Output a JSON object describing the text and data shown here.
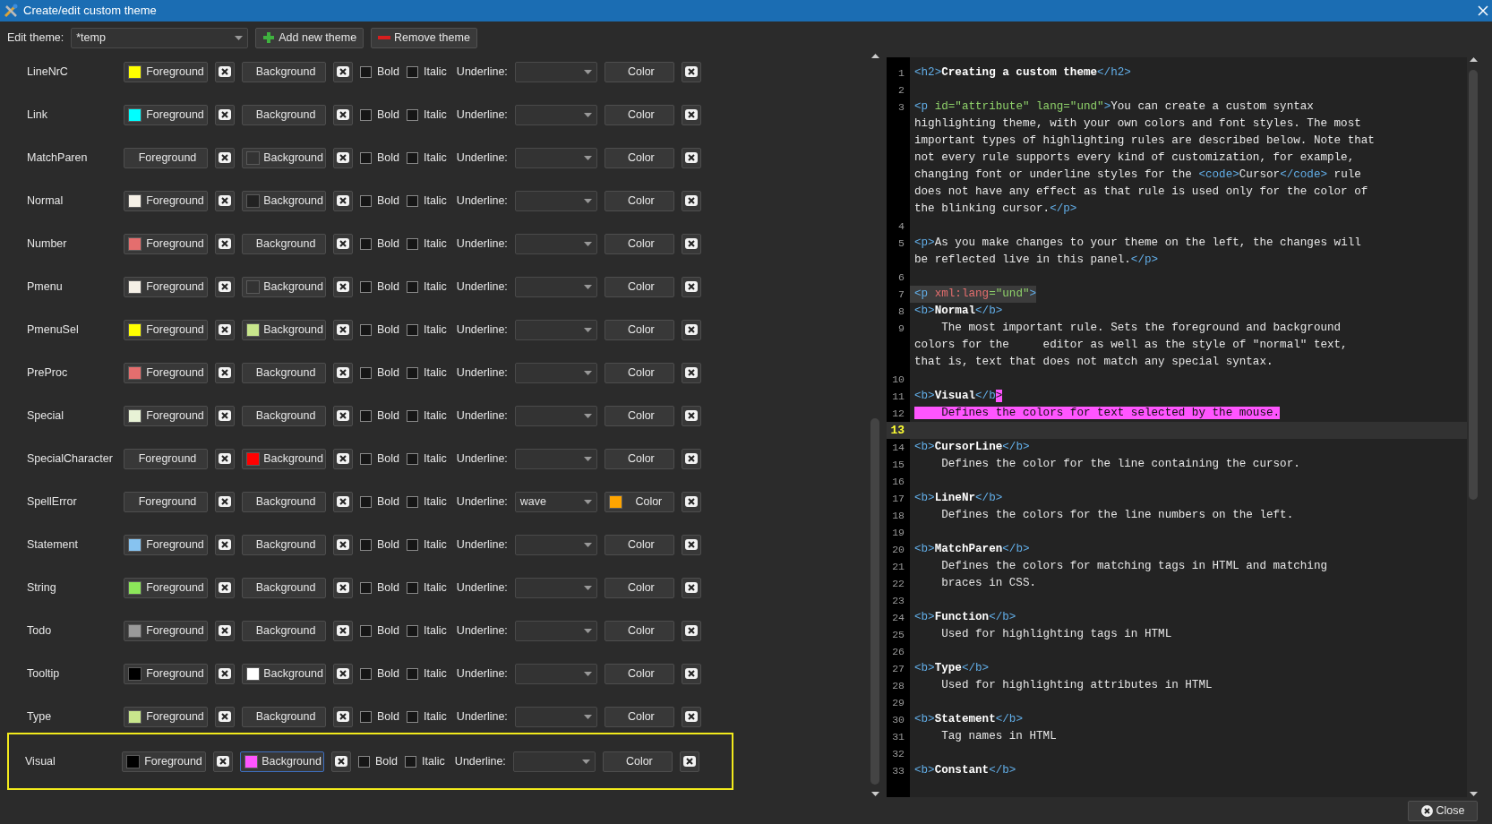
{
  "window": {
    "title": "Create/edit custom theme"
  },
  "toolbar": {
    "label": "Edit theme:",
    "theme": "*temp",
    "buttons": [
      {
        "kind": "add",
        "label": "Add new theme"
      },
      {
        "kind": "remove",
        "label": "Remove theme"
      }
    ]
  },
  "rules": [
    {
      "name": "LineNrC",
      "foreground": {
        "label": "Foreground",
        "color": "#ffff00"
      },
      "background": {
        "label": "Background"
      },
      "bold": {
        "label": "Bold",
        "checked": false
      },
      "italic": {
        "label": "Italic",
        "checked": false
      },
      "underline": {
        "label": "Underline:"
      },
      "underline_color": {
        "label": "Color"
      },
      "selected": false
    },
    {
      "name": "Link",
      "foreground": {
        "label": "Foreground",
        "color": "#00ffff"
      },
      "background": {
        "label": "Background"
      },
      "bold": {
        "label": "Bold",
        "checked": false
      },
      "italic": {
        "label": "Italic",
        "checked": false
      },
      "underline": {
        "label": "Underline:"
      },
      "underline_color": {
        "label": "Color"
      },
      "selected": false
    },
    {
      "name": "MatchParen",
      "foreground": {
        "label": "Foreground"
      },
      "background": {
        "label": "Background",
        "color": "#333333"
      },
      "bold": {
        "label": "Bold",
        "checked": false
      },
      "italic": {
        "label": "Italic",
        "checked": false
      },
      "underline": {
        "label": "Underline:"
      },
      "underline_color": {
        "label": "Color"
      },
      "selected": false
    },
    {
      "name": "Normal",
      "foreground": {
        "label": "Foreground",
        "color": "#f5f0e6"
      },
      "background": {
        "label": "Background",
        "color": "#222222"
      },
      "bold": {
        "label": "Bold",
        "checked": false
      },
      "italic": {
        "label": "Italic",
        "checked": false
      },
      "underline": {
        "label": "Underline:"
      },
      "underline_color": {
        "label": "Color"
      },
      "selected": false
    },
    {
      "name": "Number",
      "foreground": {
        "label": "Foreground",
        "color": "#e46e6e"
      },
      "background": {
        "label": "Background"
      },
      "bold": {
        "label": "Bold",
        "checked": false
      },
      "italic": {
        "label": "Italic",
        "checked": false
      },
      "underline": {
        "label": "Underline:"
      },
      "underline_color": {
        "label": "Color"
      },
      "selected": false
    },
    {
      "name": "Pmenu",
      "foreground": {
        "label": "Foreground",
        "color": "#f5f0e6"
      },
      "background": {
        "label": "Background",
        "color": "#333333"
      },
      "bold": {
        "label": "Bold",
        "checked": false
      },
      "italic": {
        "label": "Italic",
        "checked": false
      },
      "underline": {
        "label": "Underline:"
      },
      "underline_color": {
        "label": "Color"
      },
      "selected": false
    },
    {
      "name": "PmenuSel",
      "foreground": {
        "label": "Foreground",
        "color": "#ffff00"
      },
      "background": {
        "label": "Background",
        "color": "#c8e68c"
      },
      "bold": {
        "label": "Bold",
        "checked": false
      },
      "italic": {
        "label": "Italic",
        "checked": false
      },
      "underline": {
        "label": "Underline:"
      },
      "underline_color": {
        "label": "Color"
      },
      "selected": false
    },
    {
      "name": "PreProc",
      "foreground": {
        "label": "Foreground",
        "color": "#e46e6e"
      },
      "background": {
        "label": "Background"
      },
      "bold": {
        "label": "Bold",
        "checked": false
      },
      "italic": {
        "label": "Italic",
        "checked": false
      },
      "underline": {
        "label": "Underline:"
      },
      "underline_color": {
        "label": "Color"
      },
      "selected": false
    },
    {
      "name": "Special",
      "foreground": {
        "label": "Foreground",
        "color": "#e8f2d6"
      },
      "background": {
        "label": "Background"
      },
      "bold": {
        "label": "Bold",
        "checked": false
      },
      "italic": {
        "label": "Italic",
        "checked": false
      },
      "underline": {
        "label": "Underline:"
      },
      "underline_color": {
        "label": "Color"
      },
      "selected": false
    },
    {
      "name": "SpecialCharacter",
      "foreground": {
        "label": "Foreground"
      },
      "background": {
        "label": "Background",
        "color": "#ff0000"
      },
      "bold": {
        "label": "Bold",
        "checked": false
      },
      "italic": {
        "label": "Italic",
        "checked": false
      },
      "underline": {
        "label": "Underline:"
      },
      "underline_color": {
        "label": "Color"
      },
      "selected": false
    },
    {
      "name": "SpellError",
      "foreground": {
        "label": "Foreground"
      },
      "background": {
        "label": "Background"
      },
      "bold": {
        "label": "Bold",
        "checked": false
      },
      "italic": {
        "label": "Italic",
        "checked": false
      },
      "underline": {
        "label": "Underline:",
        "value": "wave"
      },
      "underline_color": {
        "label": "Color",
        "color": "#ffa500"
      },
      "selected": false
    },
    {
      "name": "Statement",
      "foreground": {
        "label": "Foreground",
        "color": "#87c3f0"
      },
      "background": {
        "label": "Background"
      },
      "bold": {
        "label": "Bold",
        "checked": false
      },
      "italic": {
        "label": "Italic",
        "checked": false
      },
      "underline": {
        "label": "Underline:"
      },
      "underline_color": {
        "label": "Color"
      },
      "selected": false
    },
    {
      "name": "String",
      "foreground": {
        "label": "Foreground",
        "color": "#8ce65a"
      },
      "background": {
        "label": "Background"
      },
      "bold": {
        "label": "Bold",
        "checked": false
      },
      "italic": {
        "label": "Italic",
        "checked": false
      },
      "underline": {
        "label": "Underline:"
      },
      "underline_color": {
        "label": "Color"
      },
      "selected": false
    },
    {
      "name": "Todo",
      "foreground": {
        "label": "Foreground",
        "color": "#9a9a9a"
      },
      "background": {
        "label": "Background"
      },
      "bold": {
        "label": "Bold",
        "checked": false
      },
      "italic": {
        "label": "Italic",
        "checked": false
      },
      "underline": {
        "label": "Underline:"
      },
      "underline_color": {
        "label": "Color"
      },
      "selected": false
    },
    {
      "name": "Tooltip",
      "foreground": {
        "label": "Foreground",
        "color": "#000000"
      },
      "background": {
        "label": "Background",
        "color": "#ffffff"
      },
      "bold": {
        "label": "Bold",
        "checked": false
      },
      "italic": {
        "label": "Italic",
        "checked": false
      },
      "underline": {
        "label": "Underline:"
      },
      "underline_color": {
        "label": "Color"
      },
      "selected": false
    },
    {
      "name": "Type",
      "foreground": {
        "label": "Foreground",
        "color": "#c8e68c"
      },
      "background": {
        "label": "Background"
      },
      "bold": {
        "label": "Bold",
        "checked": false
      },
      "italic": {
        "label": "Italic",
        "checked": false
      },
      "underline": {
        "label": "Underline:"
      },
      "underline_color": {
        "label": "Color"
      },
      "selected": false
    },
    {
      "name": "Visual",
      "foreground": {
        "label": "Foreground",
        "color": "#000000"
      },
      "background": {
        "label": "Background",
        "color": "#ff55ff"
      },
      "bold": {
        "label": "Bold",
        "checked": false
      },
      "italic": {
        "label": "Italic",
        "checked": false
      },
      "underline": {
        "label": "Underline:"
      },
      "underline_color": {
        "label": "Color"
      },
      "selected": true
    }
  ],
  "editor": {
    "lines": [
      {
        "number": "1",
        "current": false,
        "matched": false,
        "segments": [
          {
            "kind": "tag",
            "text": "<h2>"
          },
          {
            "kind": "bold",
            "text": "Creating a custom theme"
          },
          {
            "kind": "tag",
            "text": "</h2>"
          }
        ]
      },
      {
        "number": "2",
        "current": false,
        "matched": false
      },
      {
        "number": "3",
        "current": false,
        "matched": false,
        "segments": [
          {
            "kind": "tag",
            "text": "<p "
          },
          {
            "kind": "attr",
            "text": "id=\"attribute\" lang=\"und\""
          },
          {
            "kind": "tag",
            "text": ">"
          },
          {
            "kind": "text",
            "text": "You can create a custom syntax"
          }
        ]
      },
      {
        "current": false,
        "matched": false,
        "segments": [
          {
            "kind": "text",
            "text": "highlighting theme, with your own colors and font styles. The most"
          }
        ]
      },
      {
        "current": false,
        "matched": false,
        "segments": [
          {
            "kind": "text",
            "text": "important types of highlighting rules are described below. Note that"
          }
        ]
      },
      {
        "current": false,
        "matched": false,
        "segments": [
          {
            "kind": "text",
            "text": "not every rule supports every kind of customization, for example,"
          }
        ]
      },
      {
        "current": false,
        "matched": false,
        "segments": [
          {
            "kind": "text",
            "text": "changing font or underline styles for the "
          },
          {
            "kind": "tag",
            "text": "<code>"
          },
          {
            "kind": "text",
            "text": "Cursor"
          },
          {
            "kind": "tag",
            "text": "</code>"
          },
          {
            "kind": "text",
            "text": " rule"
          }
        ]
      },
      {
        "current": false,
        "matched": false,
        "segments": [
          {
            "kind": "text",
            "text": "does not have any effect as that rule is used only for the color of"
          }
        ]
      },
      {
        "current": false,
        "matched": false,
        "segments": [
          {
            "kind": "text",
            "text": "the blinking cursor."
          },
          {
            "kind": "tag",
            "text": "</p>"
          }
        ]
      },
      {
        "number": "4",
        "current": false,
        "matched": false
      },
      {
        "number": "5",
        "current": false,
        "matched": false,
        "segments": [
          {
            "kind": "tag",
            "text": "<p>"
          },
          {
            "kind": "text",
            "text": "As you make changes to your theme on the left, the changes will"
          }
        ]
      },
      {
        "current": false,
        "matched": false,
        "segments": [
          {
            "kind": "text",
            "text": "be reflected live in this panel."
          },
          {
            "kind": "tag",
            "text": "</p>"
          }
        ]
      },
      {
        "number": "6",
        "current": false,
        "matched": false
      },
      {
        "number": "7",
        "current": false,
        "matched": true,
        "segments": [
          {
            "kind": "tag",
            "text": "<p "
          },
          {
            "kind": "namespace",
            "text": "xml:lang"
          },
          {
            "kind": "attr",
            "text": "=\"und\""
          },
          {
            "kind": "tag",
            "text": ">"
          }
        ]
      },
      {
        "number": "8",
        "current": false,
        "matched": false,
        "segments": [
          {
            "kind": "tag",
            "text": "<b>"
          },
          {
            "kind": "bold",
            "text": "Normal"
          },
          {
            "kind": "tag",
            "text": "</b>"
          }
        ]
      },
      {
        "number": "9",
        "current": false,
        "matched": false,
        "segments": [
          {
            "kind": "text",
            "text": "    The most important rule. Sets the foreground and background"
          }
        ]
      },
      {
        "current": false,
        "matched": false,
        "segments": [
          {
            "kind": "text",
            "text": "colors for the     editor as well as the style of \"normal\" text,"
          }
        ]
      },
      {
        "current": false,
        "matched": false,
        "segments": [
          {
            "kind": "text",
            "text": "that is, text that does not match any special syntax."
          }
        ]
      },
      {
        "number": "10",
        "current": false,
        "matched": false
      },
      {
        "number": "11",
        "current": false,
        "matched": false,
        "segments": [
          {
            "kind": "tag",
            "text": "<b>"
          },
          {
            "kind": "bold",
            "text": "Visual"
          },
          {
            "kind": "tag",
            "text": "</b"
          },
          {
            "kind": "selected",
            "text": ">"
          }
        ]
      },
      {
        "number": "12",
        "current": false,
        "matched": false,
        "segments": [
          {
            "kind": "selected",
            "text": "    Defines the colors for text selected by the mouse."
          }
        ]
      },
      {
        "number": "13",
        "current": true,
        "matched": false
      },
      {
        "number": "14",
        "current": false,
        "matched": false,
        "segments": [
          {
            "kind": "tag",
            "text": "<b>"
          },
          {
            "kind": "bold",
            "text": "CursorLine"
          },
          {
            "kind": "tag",
            "text": "</b>"
          }
        ]
      },
      {
        "number": "15",
        "current": false,
        "matched": false,
        "segments": [
          {
            "kind": "text",
            "text": "    Defines the color for the line containing the cursor."
          }
        ]
      },
      {
        "number": "16",
        "current": false,
        "matched": false
      },
      {
        "number": "17",
        "current": false,
        "matched": false,
        "segments": [
          {
            "kind": "tag",
            "text": "<b>"
          },
          {
            "kind": "bold",
            "text": "LineNr"
          },
          {
            "kind": "tag",
            "text": "</b>"
          }
        ]
      },
      {
        "number": "18",
        "current": false,
        "matched": false,
        "segments": [
          {
            "kind": "text",
            "text": "    Defines the colors for the line numbers on the left."
          }
        ]
      },
      {
        "number": "19",
        "current": false,
        "matched": false
      },
      {
        "number": "20",
        "current": false,
        "matched": false,
        "segments": [
          {
            "kind": "tag",
            "text": "<b>"
          },
          {
            "kind": "bold",
            "text": "MatchParen"
          },
          {
            "kind": "tag",
            "text": "</b>"
          }
        ]
      },
      {
        "number": "21",
        "current": false,
        "matched": false,
        "segments": [
          {
            "kind": "text",
            "text": "    Defines the colors for matching tags in HTML and matching"
          }
        ]
      },
      {
        "number": "22",
        "current": false,
        "matched": false,
        "segments": [
          {
            "kind": "text",
            "text": "    braces in CSS."
          }
        ]
      },
      {
        "number": "23",
        "current": false,
        "matched": false
      },
      {
        "number": "24",
        "current": false,
        "matched": false,
        "segments": [
          {
            "kind": "tag",
            "text": "<b>"
          },
          {
            "kind": "bold",
            "text": "Function"
          },
          {
            "kind": "tag",
            "text": "</b>"
          }
        ]
      },
      {
        "number": "25",
        "current": false,
        "matched": false,
        "segments": [
          {
            "kind": "text",
            "text": "    Used for highlighting tags in HTML"
          }
        ]
      },
      {
        "number": "26",
        "current": false,
        "matched": false
      },
      {
        "number": "27",
        "current": false,
        "matched": false,
        "segments": [
          {
            "kind": "tag",
            "text": "<b>"
          },
          {
            "kind": "bold",
            "text": "Type"
          },
          {
            "kind": "tag",
            "text": "</b>"
          }
        ]
      },
      {
        "number": "28",
        "current": false,
        "matched": false,
        "segments": [
          {
            "kind": "text",
            "text": "    Used for highlighting attributes in HTML"
          }
        ]
      },
      {
        "number": "29",
        "current": false,
        "matched": false
      },
      {
        "number": "30",
        "current": false,
        "matched": false,
        "segments": [
          {
            "kind": "tag",
            "text": "<b>"
          },
          {
            "kind": "bold",
            "text": "Statement"
          },
          {
            "kind": "tag",
            "text": "</b>"
          }
        ]
      },
      {
        "number": "31",
        "current": false,
        "matched": false,
        "segments": [
          {
            "kind": "text",
            "text": "    Tag names in HTML"
          }
        ]
      },
      {
        "number": "32",
        "current": false,
        "matched": false
      },
      {
        "number": "33",
        "current": false,
        "matched": false,
        "segments": [
          {
            "kind": "tag",
            "text": "<b>"
          },
          {
            "kind": "bold",
            "text": "Constant"
          },
          {
            "kind": "tag",
            "text": "</b>"
          }
        ]
      }
    ]
  },
  "footer": {
    "close_label": "Close"
  }
}
